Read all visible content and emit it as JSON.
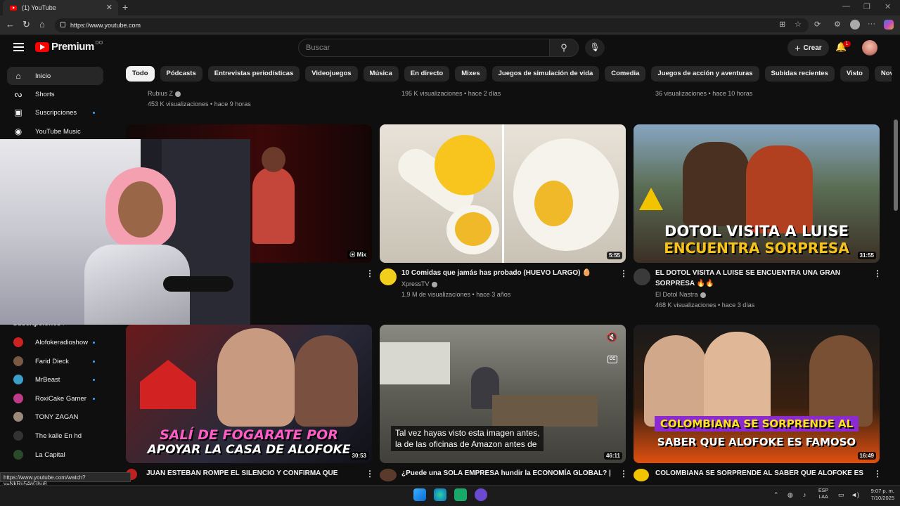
{
  "browser": {
    "tab_title": "(1) YouTube",
    "url": "https://www.youtube.com",
    "status_url": "https://www.youtube.com/watch?v=NkRu54aGbu8"
  },
  "header": {
    "logo_text": "Premium",
    "logo_sup": "DO",
    "search_placeholder": "Buscar",
    "create_label": "Crear",
    "notif_count": "1"
  },
  "chips": [
    "Todo",
    "Pódcasts",
    "Entrevistas periodísticas",
    "Videojuegos",
    "Música",
    "En directo",
    "Mixes",
    "Juegos de simulación de vida",
    "Comedia",
    "Juegos de acción y aventuras",
    "Subidas recientes",
    "Visto",
    "Novedad para ti"
  ],
  "sidebar": {
    "items": [
      {
        "label": "Inicio",
        "icon": "home-icon"
      },
      {
        "label": "Shorts",
        "icon": "shorts-icon"
      },
      {
        "label": "Suscripciones",
        "icon": "subscriptions-icon"
      },
      {
        "label": "YouTube Music",
        "icon": "music-icon"
      }
    ],
    "subs_heading": "Suscripciones",
    "subs": [
      {
        "label": "Alofokeradioshow",
        "color": "#cc2222"
      },
      {
        "label": "Farid Dieck",
        "color": "#7a5a44"
      },
      {
        "label": "MrBeast",
        "color": "#3aa0c8"
      },
      {
        "label": "RoxiCake Gamer",
        "color": "#c03a8a"
      },
      {
        "label": "TONY ZAGAN",
        "color": "#9a8a7a"
      },
      {
        "label": "The kalle En hd",
        "color": "#333333"
      },
      {
        "label": "La Capital",
        "color": "#2a4a2a"
      }
    ]
  },
  "top_row": {
    "col1_channel": "Rubius Z",
    "col1_stats": "453 K visualizaciones • hace 9 horas",
    "col2_stats": "195 K visualizaciones • hace 2 días",
    "col3_stats": "36 visualizaciones • hace 10 horas"
  },
  "videos_row2": [
    {
      "badge": "Mix"
    },
    {
      "duration": "5:55",
      "title": "10 Comidas que jamás has probado (HUEVO LARGO) 🥚",
      "channel": "XpressTV",
      "stats": "1,9 M de visualizaciones • hace 3 años"
    },
    {
      "duration": "31:55",
      "title_line1": "EL DOTOL VISITA A LUISE SE ENCUENTRA UNA GRAN",
      "title_line2": "SORPRESA 🔥🔥",
      "channel": "El Dotol Nastra",
      "stats": "468 K visualizaciones • hace 3 días",
      "overlay1": "DOTOL VISITA A LUISE",
      "overlay2": "ENCUENTRA SORPRESA"
    }
  ],
  "videos_row3": [
    {
      "duration": "30:53",
      "title": "JUAN ESTEBAN ROMPE EL SILENCIO Y CONFIRMA QUE",
      "overlay1": "SALÍ DE FOGARATE POR",
      "overlay2": "APOYAR LA CASA DE ALOFOKE"
    },
    {
      "duration": "46:11",
      "title": "¿Puede una SOLA EMPRESA hundir la ECONOMÍA GLOBAL? |",
      "caption1": "Tal vez hayas visto esta imagen antes,",
      "caption2": "la de las oficinas de Amazon antes de"
    },
    {
      "duration": "16:49",
      "title": "COLOMBIANA SE SORPRENDE AL SABER QUE ALOFOKE ES",
      "overlay1": "COLOMBIANA SE SORPRENDE AL",
      "overlay2": "SABER QUE ALOFOKE ES FAMOSO"
    }
  ],
  "taskbar": {
    "lang1": "ESP",
    "lang2": "LAA",
    "time": "9:07 p. m.",
    "date": "7/10/2025"
  }
}
